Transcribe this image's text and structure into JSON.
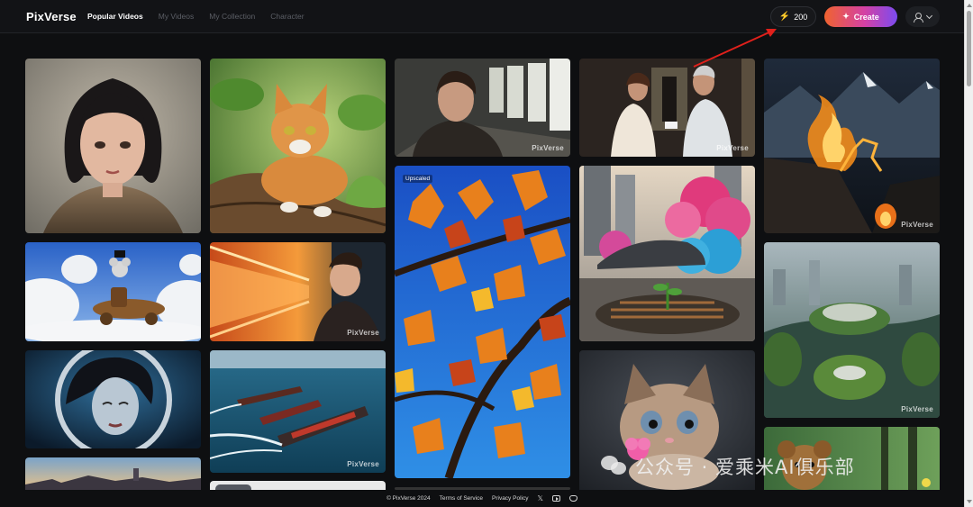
{
  "header": {
    "logo": "PixVerse",
    "nav": [
      {
        "label": "Popular Videos",
        "active": true
      },
      {
        "label": "My Videos",
        "active": false
      },
      {
        "label": "My Collection",
        "active": false
      },
      {
        "label": "Character",
        "active": false
      }
    ],
    "credits_value": "200",
    "credits_icon": "lightning-bolt-icon",
    "create_label": "Create",
    "create_icon": "sparkle-icon",
    "user_icon": "user-icon"
  },
  "gallery": {
    "watermark_text": "PixVerse",
    "upscaled_badge": "Upscaled",
    "tiles": [
      {
        "name": "tile-bob-hair-girl",
        "watermark": false
      },
      {
        "name": "tile-orange-cat-tree",
        "watermark": false
      },
      {
        "name": "tile-man-in-hallway",
        "watermark": true
      },
      {
        "name": "tile-two-people-corridor",
        "watermark": true
      },
      {
        "name": "tile-fire-fox-mountains",
        "watermark": true
      },
      {
        "name": "tile-mouse-steam-airship",
        "watermark": false
      },
      {
        "name": "tile-young-man-train",
        "watermark": true
      },
      {
        "name": "tile-autumn-leaves-sky",
        "watermark": false,
        "upscaled": true
      },
      {
        "name": "tile-smoke-car-drain",
        "watermark": false
      },
      {
        "name": "tile-green-island-city",
        "watermark": true
      },
      {
        "name": "tile-astronaut-woman",
        "watermark": false
      },
      {
        "name": "tile-cargo-ships-sea",
        "watermark": true
      },
      {
        "name": "tile-kitten-flower",
        "watermark": false
      },
      {
        "name": "tile-teddy-bear-forest",
        "watermark": false
      },
      {
        "name": "tile-town-sunset",
        "watermark": false
      },
      {
        "name": "tile-gray-partial",
        "watermark": false
      }
    ]
  },
  "footer": {
    "copyright": "© PixVerse 2024",
    "terms": "Terms of Service",
    "privacy": "Privacy Policy",
    "icons": [
      "x-twitter-icon",
      "youtube-icon",
      "discord-icon"
    ]
  },
  "overlay": {
    "wechat_watermark": "公众号 · 爱乘米AI俱乐部"
  },
  "colors": {
    "background": "#0e0f11",
    "header": "#121316",
    "accent_gradient_start": "#f0632f",
    "accent_gradient_end": "#7b4bf0",
    "credits_bolt": "#f3c623",
    "annotation_arrow": "#e0201b"
  }
}
